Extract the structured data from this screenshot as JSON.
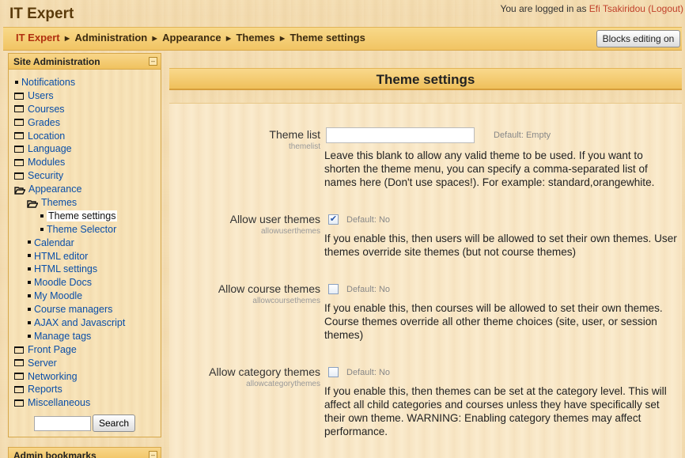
{
  "header": {
    "site_title": "IT Expert",
    "login_prefix": "You are logged in as ",
    "user_name": "Efi Tsakiridou",
    "logout_label": "(Logout)"
  },
  "breadcrumb": {
    "items": [
      "IT Expert",
      "Administration",
      "Appearance",
      "Themes",
      "Theme settings"
    ],
    "separator": "►"
  },
  "blocks_editing_button": "Blocks editing on",
  "sidebar": {
    "title": "Site Administration",
    "hide_icon": "minus-icon",
    "items": [
      {
        "label": "Notifications",
        "icon": "bullet-icon",
        "level": 0
      },
      {
        "label": "Users",
        "icon": "folder-icon",
        "level": 0
      },
      {
        "label": "Courses",
        "icon": "folder-icon",
        "level": 0
      },
      {
        "label": "Grades",
        "icon": "folder-icon",
        "level": 0
      },
      {
        "label": "Location",
        "icon": "folder-icon",
        "level": 0
      },
      {
        "label": "Language",
        "icon": "folder-icon",
        "level": 0
      },
      {
        "label": "Modules",
        "icon": "folder-icon",
        "level": 0
      },
      {
        "label": "Security",
        "icon": "folder-icon",
        "level": 0
      },
      {
        "label": "Appearance",
        "icon": "folder-open-icon",
        "level": 0
      },
      {
        "label": "Themes",
        "icon": "folder-open-icon",
        "level": 1
      },
      {
        "label": "Theme settings",
        "icon": "bullet-icon",
        "level": 2
      },
      {
        "label": "Theme Selector",
        "icon": "bullet-icon",
        "level": 2
      },
      {
        "label": "Calendar",
        "icon": "bullet-icon",
        "level": 1
      },
      {
        "label": "HTML editor",
        "icon": "bullet-icon",
        "level": 1
      },
      {
        "label": "HTML settings",
        "icon": "bullet-icon",
        "level": 1
      },
      {
        "label": "Moodle Docs",
        "icon": "bullet-icon",
        "level": 1
      },
      {
        "label": "My Moodle",
        "icon": "bullet-icon",
        "level": 1
      },
      {
        "label": "Course managers",
        "icon": "bullet-icon",
        "level": 1
      },
      {
        "label": "AJAX and Javascript",
        "icon": "bullet-icon",
        "level": 1
      },
      {
        "label": "Manage tags",
        "icon": "bullet-icon",
        "level": 1
      },
      {
        "label": "Front Page",
        "icon": "folder-icon",
        "level": 0
      },
      {
        "label": "Server",
        "icon": "folder-icon",
        "level": 0
      },
      {
        "label": "Networking",
        "icon": "folder-icon",
        "level": 0
      },
      {
        "label": "Reports",
        "icon": "folder-icon",
        "level": 0
      },
      {
        "label": "Miscellaneous",
        "icon": "folder-icon",
        "level": 0
      }
    ],
    "search_value": "",
    "search_button": "Search"
  },
  "second_block": {
    "title": "Admin bookmarks"
  },
  "main": {
    "page_title": "Theme settings",
    "settings": [
      {
        "label": "Theme list",
        "code": "themelist",
        "type": "text",
        "value": "",
        "default": "Default: Empty",
        "description": "Leave this blank to allow any valid theme to be used. If you want to shorten the theme menu, you can specify a comma-separated list of names here (Don't use spaces!). For example: standard,orangewhite."
      },
      {
        "label": "Allow user themes",
        "code": "allowuserthemes",
        "type": "checkbox",
        "checked": true,
        "default": "Default: No",
        "description": "If you enable this, then users will be allowed to set their own themes. User themes override site themes (but not course themes)"
      },
      {
        "label": "Allow course themes",
        "code": "allowcoursethemes",
        "type": "checkbox",
        "checked": false,
        "default": "Default: No",
        "description": "If you enable this, then courses will be allowed to set their own themes. Course themes override all other theme choices (site, user, or session themes)"
      },
      {
        "label": "Allow category themes",
        "code": "allowcategorythemes",
        "type": "checkbox",
        "checked": false,
        "default": "Default: No",
        "description": "If you enable this, then themes can be set at the category level. This will affect all child categories and courses unless they have specifically set their own theme. WARNING: Enabling category themes may affect performance."
      }
    ]
  },
  "colors": {
    "link": "#0b4fa8",
    "home_link": "#b03010",
    "username": "#c0402a",
    "header_bar": "#f1c463"
  }
}
